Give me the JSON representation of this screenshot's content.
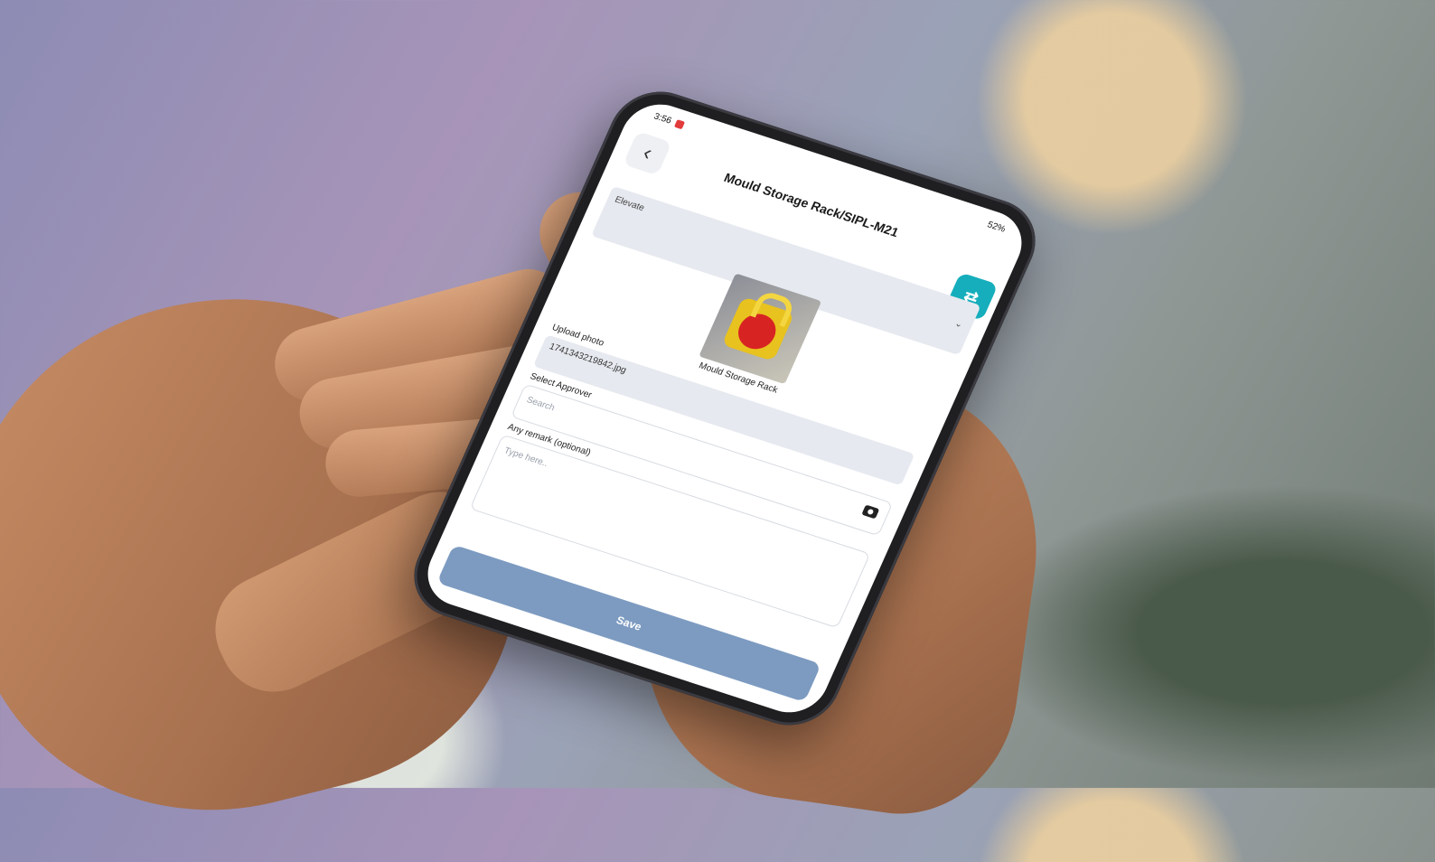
{
  "status_bar": {
    "time": "3:56",
    "indicator": "●",
    "battery": "52%"
  },
  "header": {
    "back_icon": "‹",
    "title": "Mould Storage Rack/SIPL-M21",
    "swap_icon": "⇄"
  },
  "form": {
    "dropdown": {
      "value": "Elevate",
      "chevron": "⌄"
    },
    "photo_caption": "Mould Storage Rack",
    "upload_photo": {
      "label": "Upload photo",
      "file_name": "1741343219842.jpg"
    },
    "approver": {
      "label": "Select Approver",
      "placeholder": "Search"
    },
    "remark": {
      "label": "Any remark (optional)",
      "placeholder": "Type here.."
    }
  },
  "actions": {
    "save_label": "Save"
  }
}
